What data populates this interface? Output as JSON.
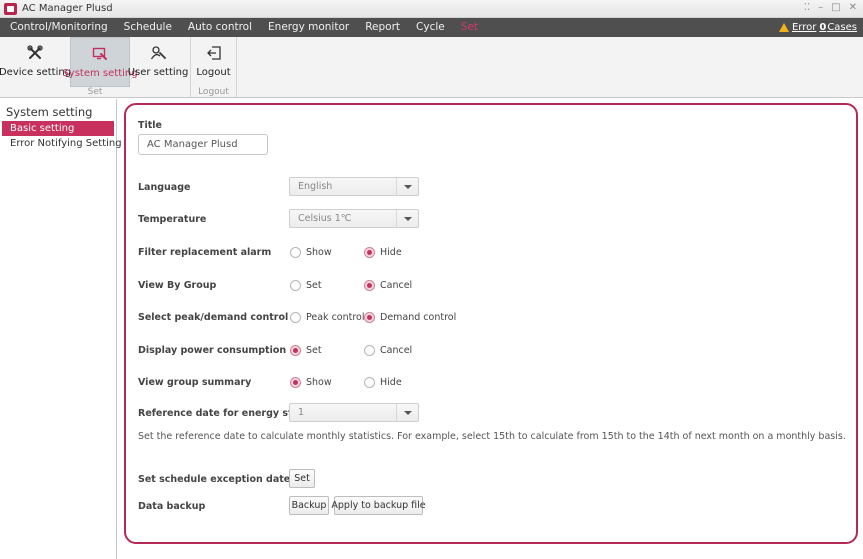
{
  "window": {
    "title": "AC Manager Plusd",
    "controls": [
      "⁚⁚",
      "–",
      "□",
      "✕"
    ]
  },
  "menu": {
    "items": [
      {
        "label": "Control/Monitoring"
      },
      {
        "label": "Schedule"
      },
      {
        "label": "Auto control"
      },
      {
        "label": "Energy monitor"
      },
      {
        "label": "Report"
      },
      {
        "label": "Cycle"
      },
      {
        "label": "Set",
        "active": true
      }
    ],
    "error": {
      "prefix": "Error",
      "count": "0",
      "suffix": "Cases"
    }
  },
  "ribbon": {
    "set_group": {
      "label": "Set",
      "buttons": [
        {
          "label": "Device setting",
          "icon": "tools-icon"
        },
        {
          "label": "System setting",
          "icon": "system-setting-icon",
          "selected": true
        },
        {
          "label": "User setting",
          "icon": "user-setting-icon"
        }
      ]
    },
    "logout_group": {
      "label": "Logout",
      "buttons": [
        {
          "label": "Logout",
          "icon": "logout-icon"
        }
      ]
    }
  },
  "sidebar": {
    "title": "System setting",
    "items": [
      {
        "label": "Basic setting",
        "active": true
      },
      {
        "label": "Error Notifying Setting"
      }
    ]
  },
  "form": {
    "title_label": "Title",
    "title_value": "AC Manager Plusd",
    "language": {
      "label": "Language",
      "value": "English"
    },
    "temperature": {
      "label": "Temperature",
      "value": "Celsius 1℃"
    },
    "filter_alarm": {
      "label": "Filter replacement alarm",
      "options": [
        "Show",
        "Hide"
      ],
      "selected": "Hide"
    },
    "view_by_group": {
      "label": "View By Group",
      "options": [
        "Set",
        "Cancel"
      ],
      "selected": "Cancel"
    },
    "peak_demand": {
      "label": "Select peak/demand control",
      "options": [
        "Peak control",
        "Demand control"
      ],
      "selected": "Demand control"
    },
    "power_consumption": {
      "label": "Display power consumption",
      "options": [
        "Set",
        "Cancel"
      ],
      "selected": "Set"
    },
    "group_summary": {
      "label": "View group summary",
      "options": [
        "Show",
        "Hide"
      ],
      "selected": "Show"
    },
    "reference_date": {
      "label": "Reference date for energy statistics",
      "value": "1"
    },
    "reference_desc": "Set the reference date to calculate monthly statistics. For example, select 15th to calculate from 15th to the 14th of next month on a monthly basis.",
    "schedule_exception": {
      "label": "Set schedule exception date",
      "button": "Set"
    },
    "data_backup": {
      "label": "Data backup",
      "buttons": [
        "Backup",
        "Apply to backup file"
      ]
    }
  },
  "colors": {
    "accent": "#c8305e",
    "menubar": "#4f4f4f",
    "panel_border": "#b52a55",
    "warning": "#f3b11c"
  }
}
